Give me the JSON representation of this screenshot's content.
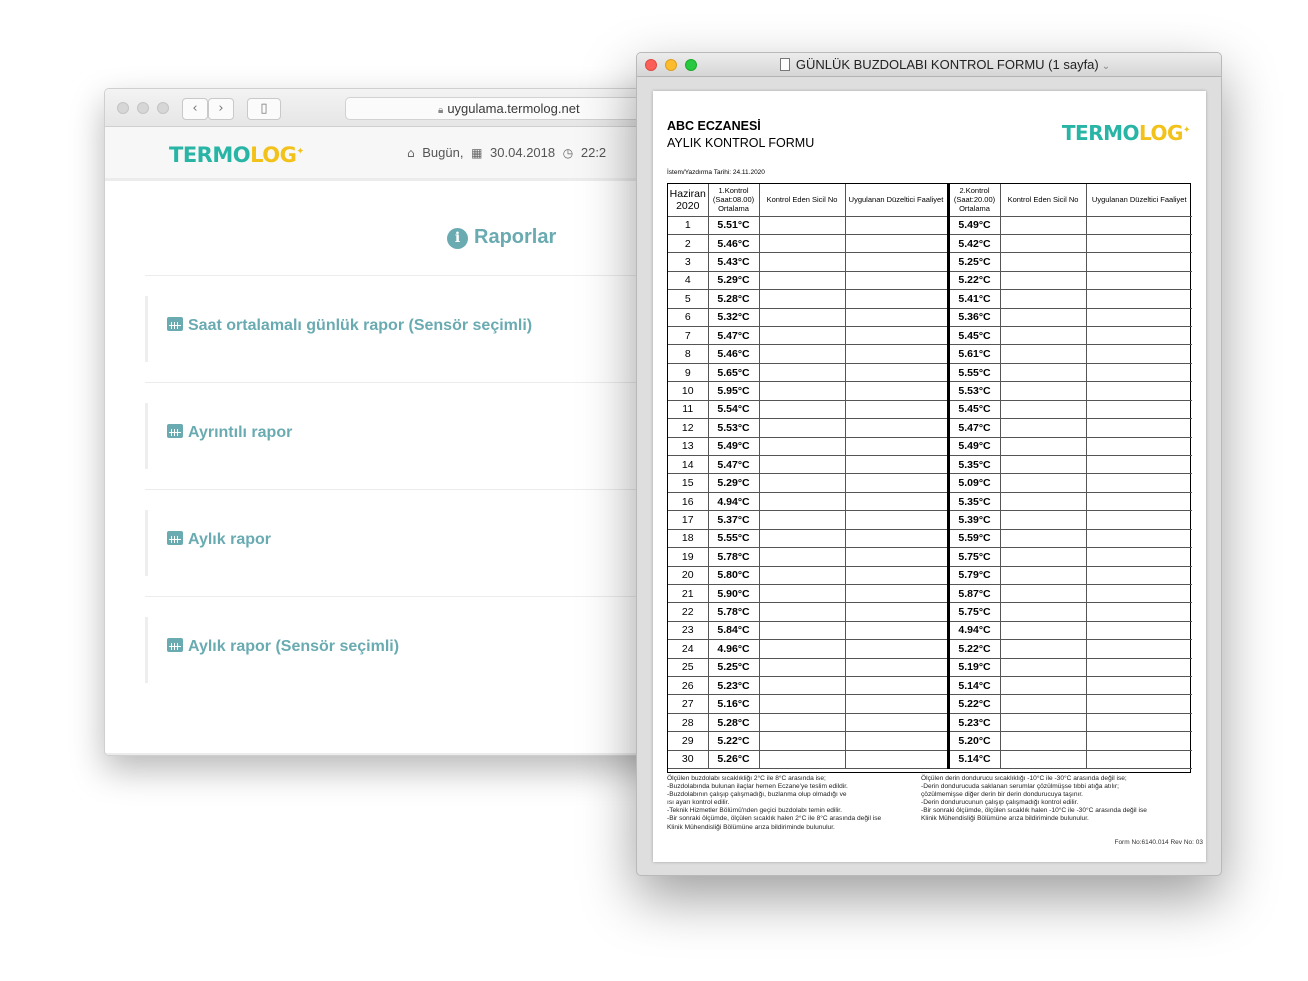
{
  "browser": {
    "url": "uygulama.termolog.net",
    "back_icon": "chevron-left-icon",
    "forward_icon": "chevron-right-icon",
    "sidebar_icon": "sidebar-icon",
    "logo": {
      "first": "TERMO",
      "second": "LOG"
    },
    "nav": {
      "today_label": "Bugün,",
      "date": "30.04.2018",
      "time": "22:2"
    },
    "reports_title": "Raporlar",
    "reports": [
      {
        "label": "Saat ortalamalı günlük rapor (Sensör seçimli)"
      },
      {
        "label": "Ayrıntılı rapor"
      },
      {
        "label": "Aylık rapor"
      },
      {
        "label": "Aylık rapor (Sensör seçimli)"
      }
    ],
    "colors": {
      "accent": "#6aabb2",
      "logo_teal": "#29b5a5",
      "logo_yellow": "#f2c21a"
    }
  },
  "preview": {
    "window_title": "GÜNLÜK BUZDOLABI KONTROL FORMU (1 sayfa)",
    "doc": {
      "company": "ABC ECZANESİ",
      "form_name": "AYLIK KONTROL FORMU",
      "print_date": "İstem/Yazdırma Tarihi: 24.11.2020",
      "logo": {
        "first": "TERMO",
        "second": "LOG"
      },
      "headers": {
        "month": "Haziran",
        "year": "2020",
        "control1": "1.Kontrol (Saat:08.00) Ortalama",
        "inspector": "Kontrol Eden Sicil No",
        "action": "Uygulanan Düzeltici Faaliyet",
        "control2": "2.Kontrol (Saat:20.00) Ortalama"
      },
      "rows": [
        {
          "day": "1",
          "k1": "5.51°C",
          "k2": "5.49°C"
        },
        {
          "day": "2",
          "k1": "5.46°C",
          "k2": "5.42°C"
        },
        {
          "day": "3",
          "k1": "5.43°C",
          "k2": "5.25°C"
        },
        {
          "day": "4",
          "k1": "5.29°C",
          "k2": "5.22°C"
        },
        {
          "day": "5",
          "k1": "5.28°C",
          "k2": "5.41°C"
        },
        {
          "day": "6",
          "k1": "5.32°C",
          "k2": "5.36°C"
        },
        {
          "day": "7",
          "k1": "5.47°C",
          "k2": "5.45°C"
        },
        {
          "day": "8",
          "k1": "5.46°C",
          "k2": "5.61°C"
        },
        {
          "day": "9",
          "k1": "5.65°C",
          "k2": "5.55°C"
        },
        {
          "day": "10",
          "k1": "5.95°C",
          "k2": "5.53°C"
        },
        {
          "day": "11",
          "k1": "5.54°C",
          "k2": "5.45°C"
        },
        {
          "day": "12",
          "k1": "5.53°C",
          "k2": "5.47°C"
        },
        {
          "day": "13",
          "k1": "5.49°C",
          "k2": "5.49°C"
        },
        {
          "day": "14",
          "k1": "5.47°C",
          "k2": "5.35°C"
        },
        {
          "day": "15",
          "k1": "5.29°C",
          "k2": "5.09°C"
        },
        {
          "day": "16",
          "k1": "4.94°C",
          "k2": "5.35°C"
        },
        {
          "day": "17",
          "k1": "5.37°C",
          "k2": "5.39°C"
        },
        {
          "day": "18",
          "k1": "5.55°C",
          "k2": "5.59°C"
        },
        {
          "day": "19",
          "k1": "5.78°C",
          "k2": "5.75°C"
        },
        {
          "day": "20",
          "k1": "5.80°C",
          "k2": "5.79°C"
        },
        {
          "day": "21",
          "k1": "5.90°C",
          "k2": "5.87°C"
        },
        {
          "day": "22",
          "k1": "5.78°C",
          "k2": "5.75°C"
        },
        {
          "day": "23",
          "k1": "5.84°C",
          "k2": "4.94°C"
        },
        {
          "day": "24",
          "k1": "4.96°C",
          "k2": "5.22°C"
        },
        {
          "day": "25",
          "k1": "5.25°C",
          "k2": "5.19°C"
        },
        {
          "day": "26",
          "k1": "5.23°C",
          "k2": "5.14°C"
        },
        {
          "day": "27",
          "k1": "5.16°C",
          "k2": "5.22°C"
        },
        {
          "day": "28",
          "k1": "5.28°C",
          "k2": "5.23°C"
        },
        {
          "day": "29",
          "k1": "5.22°C",
          "k2": "5.20°C"
        },
        {
          "day": "30",
          "k1": "5.26°C",
          "k2": "5.14°C"
        }
      ],
      "notes_left": [
        "Ölçülen buzdolabı sıcaklıkliğı 2°C ile 8°C arasında ise;",
        "-Buzdolabında bulunan ilaçlar hemen Eczane'ye teslim edildir.",
        "-Buzdolabının çalışıp çalışmadığı, buzlanma olup olmadığı ve",
        "ısı ayarı kontrol edilir.",
        "-Teknik Hizmetler Bölümü'nden geçici buzdolabı temin edilir.",
        "-Bir sonraki ölçümde, ölçülen sıcaklık halen 2°C ile 8°C arasında değil ise",
        "Klinik Mühendisliği Bölümüne arıza bildiriminde bulunulur."
      ],
      "notes_right": [
        "Ölçülen derin dondurucu sıcaklıklığı -10°C ile -30°C arasında değil ise;",
        "-Derin dondurucuda saklanan serumlar çözülmüşse tıbbi atığa atılır;",
        "çözülmemişse diğer derin bir derin dondurucuya taşınır.",
        "-Derin dondurucunun çalışıp çalışmadığı kontrol edilir.",
        "-Bir sonraki ölçümde, ölçülen sıcaklık halen -10°C ile -30°C arasında değil ise",
        "Klinik Mühendisliği Bölümüne arıza bildiriminde bulunulur."
      ],
      "form_no": "Form No:6140.014 Rev No: 03"
    }
  }
}
